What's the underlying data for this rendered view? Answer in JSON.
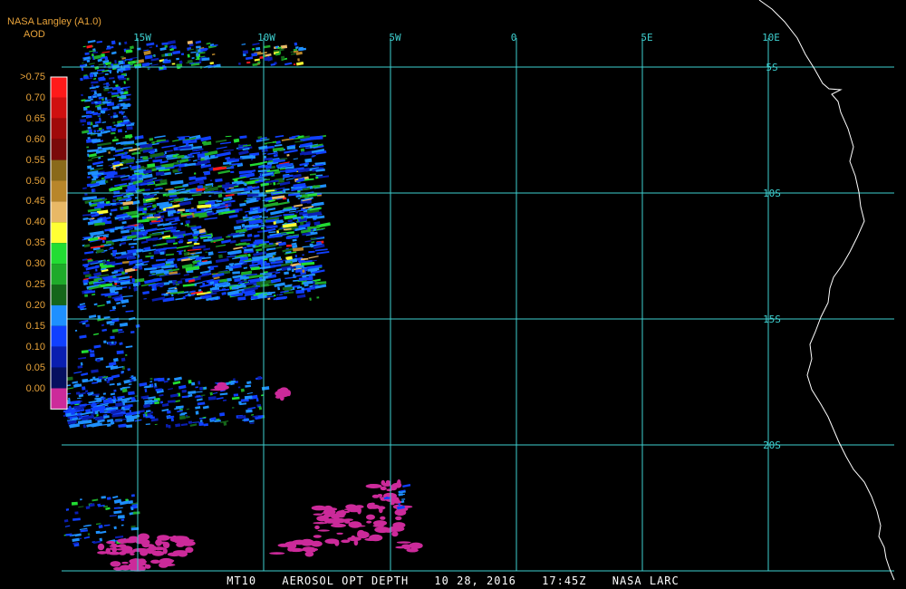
{
  "header": {
    "org": "NASA Langley (A1.0)",
    "product": "AOD"
  },
  "legend": {
    "labels": [
      ">0.75",
      "0.70",
      "0.65",
      "0.60",
      "0.55",
      "0.50",
      "0.45",
      "0.40",
      "0.35",
      "0.30",
      "0.25",
      "0.20",
      "0.15",
      "0.10",
      "0.05",
      "0.00"
    ],
    "colors": [
      "#ff1a1a",
      "#d01010",
      "#a00a0a",
      "#7a0a0a",
      "#8a6a1a",
      "#b8862a",
      "#e8b866",
      "#ffff33",
      "#22dd33",
      "#1faa2a",
      "#15661a",
      "#1e90ff",
      "#1040ff",
      "#0a1eb0",
      "#061060",
      "#cc2a9a"
    ]
  },
  "map": {
    "line_color": "#3ecfcf",
    "coast_color": "#ffffff",
    "longitude_labels": [
      "15W",
      "10W",
      "5W",
      "0",
      "5E",
      "10E"
    ],
    "latitude_labels": [
      "5S",
      "10S",
      "15S",
      "20S"
    ]
  },
  "footer": {
    "satellite": "MT10",
    "product": "AEROSOL OPT DEPTH",
    "date": "10 28, 2016",
    "time": "17:45Z",
    "agency": "NASA LARC"
  }
}
